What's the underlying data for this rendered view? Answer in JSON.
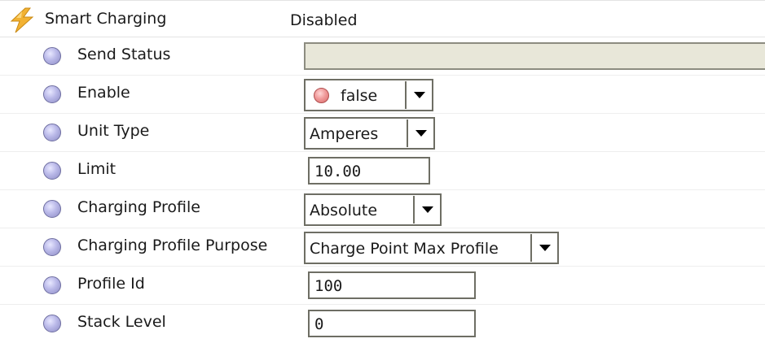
{
  "header": {
    "label": "Smart Charging",
    "value": "Disabled",
    "icon": "lightning-bolt-icon"
  },
  "rows": {
    "send_status": {
      "label": "Send Status",
      "value": ""
    },
    "enable": {
      "label": "Enable",
      "value": "false"
    },
    "unit_type": {
      "label": "Unit Type",
      "value": "Amperes"
    },
    "limit": {
      "label": "Limit",
      "value": "10.00"
    },
    "charging_profile": {
      "label": "Charging Profile",
      "value": "Absolute"
    },
    "charging_profile_purpose": {
      "label": "Charging Profile Purpose",
      "value": "Charge Point Max Profile"
    },
    "profile_id": {
      "label": "Profile Id",
      "value": "100"
    },
    "stack_level": {
      "label": "Stack Level",
      "value": "0"
    }
  },
  "colors": {
    "slot_icon": "#b9b8e8",
    "false_indicator": "#f09a9a",
    "readonly_field": "#e8e7d9",
    "bolt": "#f2b233"
  }
}
